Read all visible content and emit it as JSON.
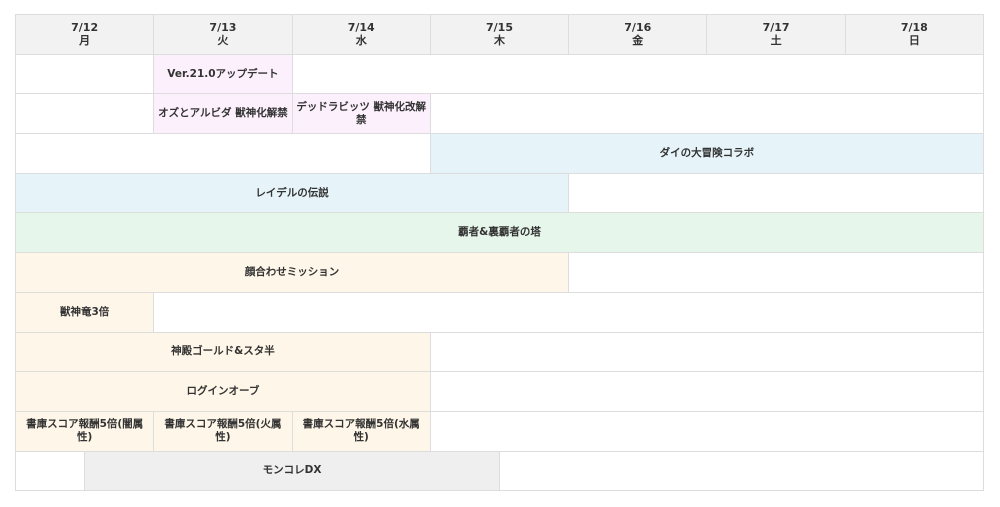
{
  "days": [
    {
      "date": "7/12",
      "weekday": "月"
    },
    {
      "date": "7/13",
      "weekday": "火"
    },
    {
      "date": "7/14",
      "weekday": "水"
    },
    {
      "date": "7/15",
      "weekday": "木"
    },
    {
      "date": "7/16",
      "weekday": "金"
    },
    {
      "date": "7/17",
      "weekday": "土"
    },
    {
      "date": "7/18",
      "weekday": "日"
    }
  ],
  "palette": {
    "pink": "#fcf0fc",
    "blue": "#e6f4f9",
    "green": "#e6f6ea",
    "cream": "#fef6e8",
    "grey": "#efefef",
    "header": "#f2f2f2",
    "border": "#dddddd"
  },
  "rows": [
    [
      {
        "span": 2,
        "label": "",
        "color": "empty"
      },
      {
        "span": 2,
        "label": "Ver.21.0アップデート",
        "color": "pink"
      },
      {
        "span": 10,
        "label": "",
        "color": "empty"
      }
    ],
    [
      {
        "span": 2,
        "label": "",
        "color": "empty"
      },
      {
        "span": 2,
        "label": "オズとアルビダ 獣神化解禁",
        "color": "pink"
      },
      {
        "span": 2,
        "label": "デッドラビッツ 獣神化改解禁",
        "color": "pink"
      },
      {
        "span": 8,
        "label": "",
        "color": "empty"
      }
    ],
    [
      {
        "span": 6,
        "label": "",
        "color": "empty"
      },
      {
        "span": 8,
        "label": "ダイの大冒険コラボ",
        "color": "blue"
      }
    ],
    [
      {
        "span": 8,
        "label": "レイデルの伝説",
        "color": "blue"
      },
      {
        "span": 6,
        "label": "",
        "color": "empty"
      }
    ],
    [
      {
        "span": 14,
        "label": "覇者&裏覇者の塔",
        "color": "green"
      }
    ],
    [
      {
        "span": 8,
        "label": "顔合わせミッション",
        "color": "cream"
      },
      {
        "span": 6,
        "label": "",
        "color": "empty"
      }
    ],
    [
      {
        "span": 2,
        "label": "獣神竜3倍",
        "color": "cream"
      },
      {
        "span": 12,
        "label": "",
        "color": "empty"
      }
    ],
    [
      {
        "span": 6,
        "label": "神殿ゴールド&スタ半",
        "color": "cream"
      },
      {
        "span": 8,
        "label": "",
        "color": "empty"
      }
    ],
    [
      {
        "span": 6,
        "label": "ログインオーブ",
        "color": "cream"
      },
      {
        "span": 8,
        "label": "",
        "color": "empty"
      }
    ],
    [
      {
        "span": 2,
        "label": "書庫スコア報酬5倍(闇属性)",
        "color": "cream"
      },
      {
        "span": 2,
        "label": "書庫スコア報酬5倍(火属性)",
        "color": "cream"
      },
      {
        "span": 2,
        "label": "書庫スコア報酬5倍(水属性)",
        "color": "cream"
      },
      {
        "span": 8,
        "label": "",
        "color": "empty"
      }
    ],
    [
      {
        "span": 1,
        "label": "",
        "color": "empty"
      },
      {
        "span": 6,
        "label": "モンコレDX",
        "color": "grey"
      },
      {
        "span": 7,
        "label": "",
        "color": "empty"
      }
    ]
  ]
}
